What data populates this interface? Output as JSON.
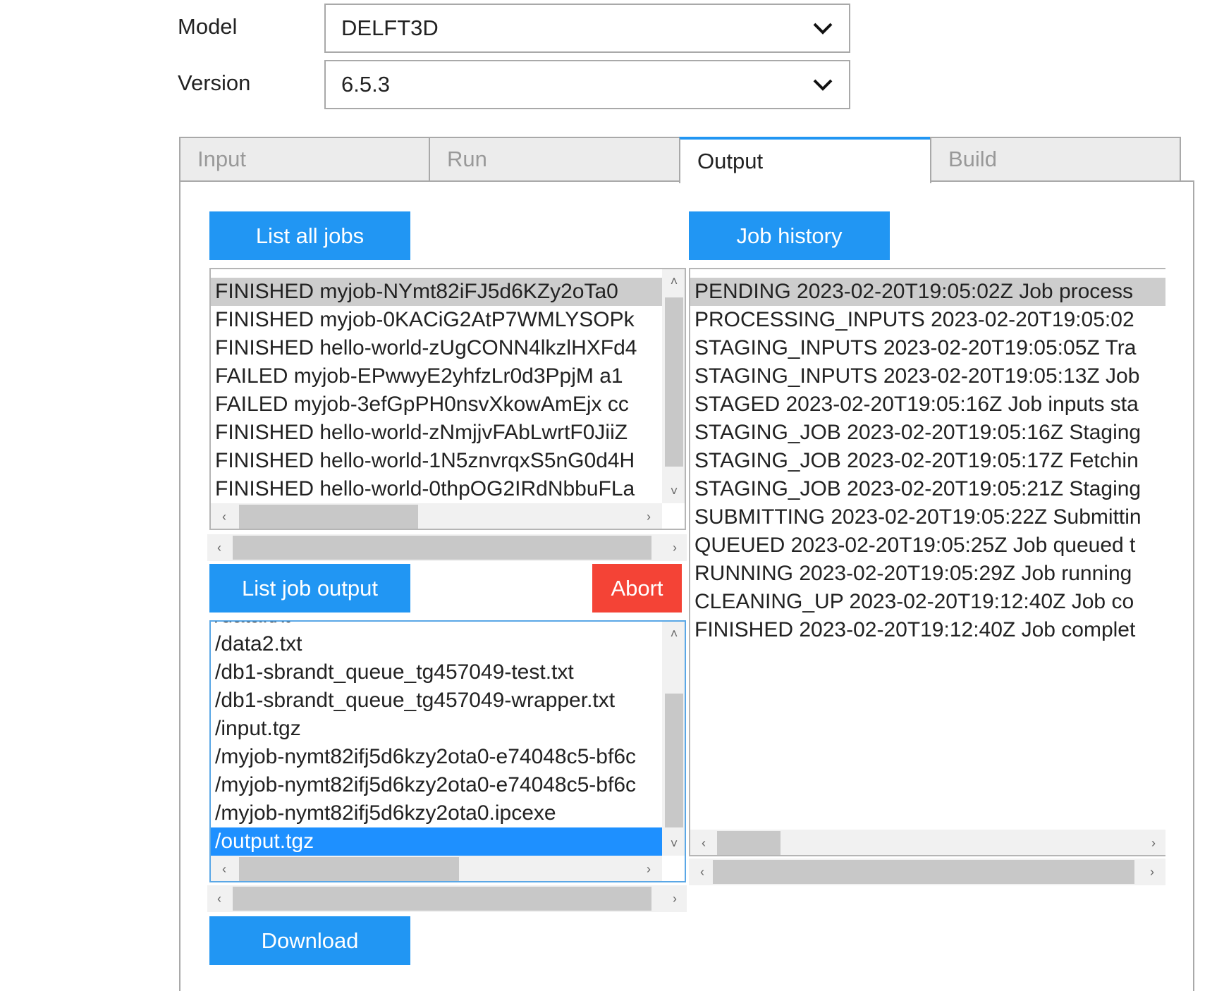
{
  "form": {
    "model_label": "Model",
    "model_value": "DELFT3D",
    "version_label": "Version",
    "version_value": "6.5.3"
  },
  "tabs": [
    {
      "label": "Input",
      "active": false
    },
    {
      "label": "Run",
      "active": false
    },
    {
      "label": "Output",
      "active": true
    },
    {
      "label": "Build",
      "active": false
    }
  ],
  "buttons": {
    "list_all_jobs": "List all jobs",
    "job_history": "Job history",
    "list_job_output": "List job output",
    "abort": "Abort",
    "download": "Download"
  },
  "jobs": [
    "FINISHED myjob-NYmt82iFJ5d6KZy2oTa0",
    "FINISHED myjob-0KACiG2AtP7WMLYSOPk",
    "FINISHED hello-world-zUgCONN4lkzlHXFd4",
    "FAILED myjob-EPwwyE2yhfzLr0d3PpjM  a1",
    "FAILED myjob-3efGpPH0nsvXkowAmEjx  cc",
    "FINISHED hello-world-zNmjjvFAbLwrtF0JiiZ",
    "FINISHED hello-world-1N5znvrqxS5nG0d4H",
    "FINISHED hello-world-0thpOG2IRdNbbuFLa"
  ],
  "outputs": [
    "/data.txt",
    "/data2.txt",
    "/db1-sbrandt_queue_tg457049-test.txt",
    "/db1-sbrandt_queue_tg457049-wrapper.txt",
    "/input.tgz",
    "/myjob-nymt82ifj5d6kzy2ota0-e74048c5-bf6c",
    "/myjob-nymt82ifj5d6kzy2ota0-e74048c5-bf6c",
    "/myjob-nymt82ifj5d6kzy2ota0.ipcexe",
    "/output.tgz"
  ],
  "history": [
    "PENDING 2023-02-20T19:05:02Z Job process",
    "PROCESSING_INPUTS 2023-02-20T19:05:02",
    "STAGING_INPUTS 2023-02-20T19:05:05Z Tra",
    "STAGING_INPUTS 2023-02-20T19:05:13Z Job",
    "STAGED 2023-02-20T19:05:16Z Job inputs sta",
    "STAGING_JOB 2023-02-20T19:05:16Z Staging",
    "STAGING_JOB 2023-02-20T19:05:17Z Fetchin",
    "STAGING_JOB 2023-02-20T19:05:21Z Staging",
    "SUBMITTING 2023-02-20T19:05:22Z Submittin",
    "QUEUED 2023-02-20T19:05:25Z Job queued t",
    "RUNNING 2023-02-20T19:05:29Z Job running",
    "CLEANING_UP 2023-02-20T19:12:40Z Job co",
    "FINISHED 2023-02-20T19:12:40Z Job complet"
  ],
  "icons": {
    "dropdown": "chevron-down-icon",
    "scroll_left": "‹",
    "scroll_right": "›",
    "scroll_up": "˄",
    "scroll_down": "˅"
  },
  "colors": {
    "accent": "#2196f3",
    "danger": "#f44336",
    "selection": "#1e90ff",
    "selection_inactive": "#cdcdcd"
  }
}
